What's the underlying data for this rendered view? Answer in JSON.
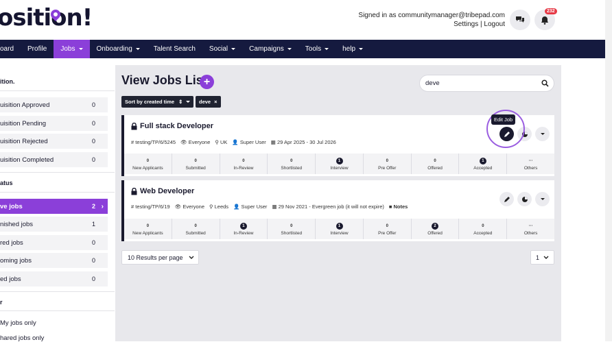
{
  "header": {
    "logo_text": "osition",
    "signed_in": "Signed in as communitymanager@tribepad.com",
    "settings": "Settings",
    "separator": "|",
    "logout": "Logout",
    "notification_count": "232"
  },
  "nav": {
    "items": [
      {
        "label": "oard"
      },
      {
        "label": "Profile"
      },
      {
        "label": "Jobs"
      },
      {
        "label": "Onboarding"
      },
      {
        "label": "Talent Search"
      },
      {
        "label": "Social"
      },
      {
        "label": "Campaigns"
      },
      {
        "label": "Tools"
      },
      {
        "label": "help"
      }
    ]
  },
  "sidebar": {
    "requisition_head": "ition.",
    "requisition": [
      {
        "label": "uisition Approved",
        "count": "0"
      },
      {
        "label": "uisition Pending",
        "count": "0"
      },
      {
        "label": "uisition Rejected",
        "count": "0"
      },
      {
        "label": "uisition Completed",
        "count": "0"
      }
    ],
    "status_head": "atus",
    "status": [
      {
        "label": "ve jobs",
        "count": "2"
      },
      {
        "label": "nished jobs",
        "count": "1"
      },
      {
        "label": "red jobs",
        "count": "0"
      },
      {
        "label": "oming jobs",
        "count": "0"
      },
      {
        "label": "ed jobs",
        "count": "0"
      }
    ],
    "owner_head": "r",
    "owner": [
      {
        "label": "My jobs only"
      },
      {
        "label": "hared jobs only"
      }
    ]
  },
  "main": {
    "title": "View Jobs List",
    "add_label": "+",
    "search_value": "deve",
    "sort_label": "Sort by created time",
    "filter_label": "deve",
    "tooltip": "Edit Job",
    "per_page": "10 Results per page",
    "page": "1"
  },
  "jobs": [
    {
      "title": "Full stack Developer",
      "ref": "testing/TP/6/5245",
      "visibility": "Everyone",
      "location": "UK",
      "owner": "Super User",
      "dates": "29 Apr 2025 - 30 Jul 2026",
      "notes": "",
      "stages": [
        {
          "label": "New Applicants",
          "count": "0",
          "on": false
        },
        {
          "label": "Submitted",
          "count": "0",
          "on": false
        },
        {
          "label": "In-Review",
          "count": "0",
          "on": false
        },
        {
          "label": "Shortlisted",
          "count": "0",
          "on": false
        },
        {
          "label": "Interview",
          "count": "1",
          "on": true
        },
        {
          "label": "Pre Offer",
          "count": "0",
          "on": false
        },
        {
          "label": "Offered",
          "count": "0",
          "on": false
        },
        {
          "label": "Accepted",
          "count": "1",
          "on": true
        },
        {
          "label": "Others",
          "count": "···",
          "on": false
        }
      ]
    },
    {
      "title": "Web Developer",
      "ref": "testing/TP/6/19",
      "visibility": "Everyone",
      "location": "Leeds",
      "owner": "Super User",
      "dates": "29 Nov 2021 - Evergreen job (it will not expire)",
      "notes": "Notes",
      "stages": [
        {
          "label": "New Applicants",
          "count": "0",
          "on": false
        },
        {
          "label": "Submitted",
          "count": "0",
          "on": false
        },
        {
          "label": "In-Review",
          "count": "1",
          "on": true
        },
        {
          "label": "Shortlisted",
          "count": "0",
          "on": false
        },
        {
          "label": "Interview",
          "count": "1",
          "on": true
        },
        {
          "label": "Pre Offer",
          "count": "0",
          "on": false
        },
        {
          "label": "Offered",
          "count": "2",
          "on": true
        },
        {
          "label": "Accepted",
          "count": "0",
          "on": false
        },
        {
          "label": "Others",
          "count": "···",
          "on": false
        }
      ]
    }
  ],
  "colors": {
    "accent": "#8b3fd9",
    "nav": "#151a3f",
    "dark": "#1a1a2e"
  }
}
